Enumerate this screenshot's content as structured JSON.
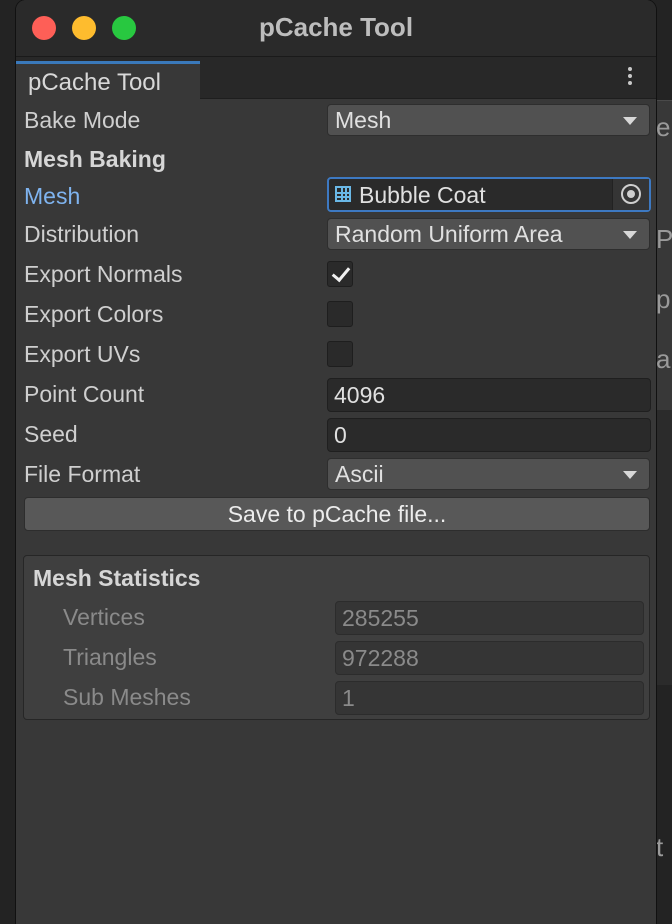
{
  "window": {
    "title": "pCache Tool",
    "tab_label": "pCache Tool"
  },
  "background": {
    "glyphs": [
      "e",
      "Po",
      "p",
      "a",
      "t"
    ]
  },
  "fields": {
    "bake_mode": {
      "label": "Bake Mode",
      "value": "Mesh"
    },
    "section_heading": "Mesh Baking",
    "mesh": {
      "label": "Mesh",
      "value": "Bubble Coat",
      "icon": "mesh-icon"
    },
    "distribution": {
      "label": "Distribution",
      "value": "Random Uniform Area"
    },
    "export_normals": {
      "label": "Export Normals",
      "checked": true
    },
    "export_colors": {
      "label": "Export Colors",
      "checked": false
    },
    "export_uvs": {
      "label": "Export UVs",
      "checked": false
    },
    "point_count": {
      "label": "Point Count",
      "value": "4096"
    },
    "seed": {
      "label": "Seed",
      "value": "0"
    },
    "file_format": {
      "label": "File Format",
      "value": "Ascii"
    }
  },
  "save_button": "Save to pCache file...",
  "stats": {
    "title": "Mesh Statistics",
    "vertices": {
      "label": "Vertices",
      "value": "285255"
    },
    "triangles": {
      "label": "Triangles",
      "value": "972288"
    },
    "sub_meshes": {
      "label": "Sub Meshes",
      "value": "1"
    }
  },
  "colors": {
    "accent": "#3d79c2",
    "panel": "#383838",
    "close": "#fe5f57",
    "minimize": "#febc2e",
    "zoom": "#28c840"
  }
}
